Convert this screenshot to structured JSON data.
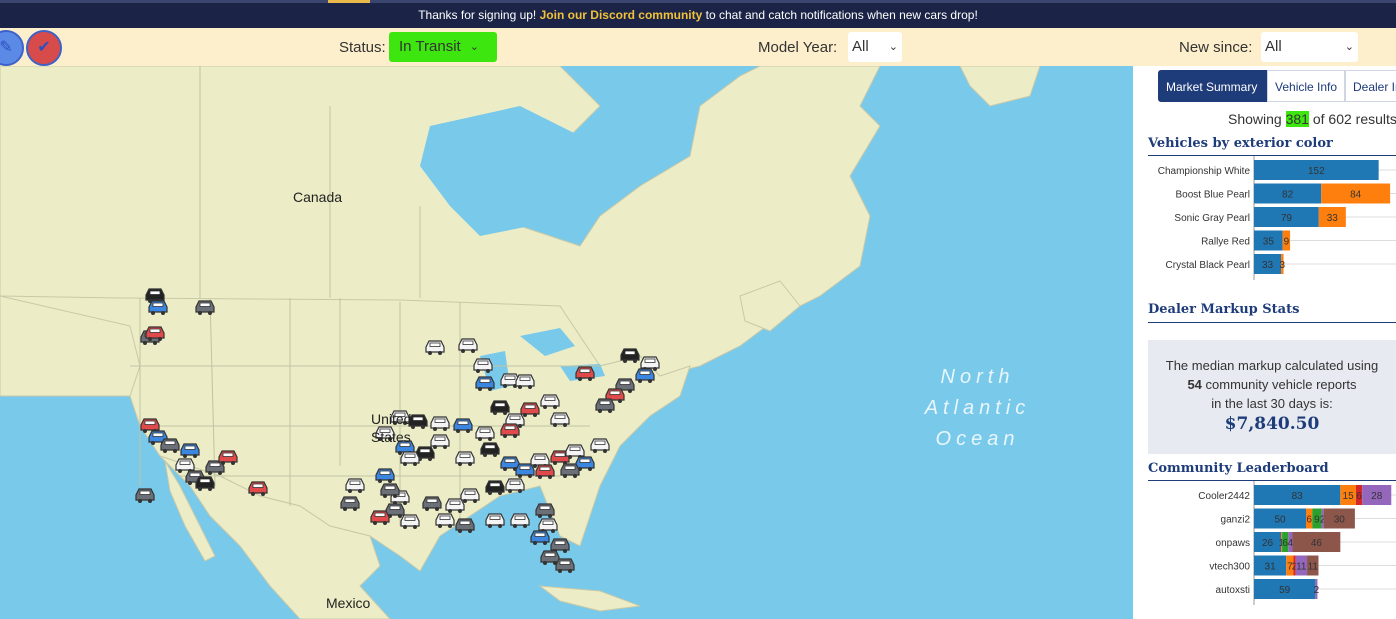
{
  "banner": {
    "prefix": "Thanks for signing up! ",
    "link": "Join our Discord community",
    "suffix": " to chat and catch notifications when new cars drop!"
  },
  "filters": {
    "status_label": "Status:",
    "status_value": "In Transit",
    "model_year_label": "Model Year:",
    "model_year_value": "All",
    "new_since_label": "New since:",
    "new_since_value": "All"
  },
  "map": {
    "labels": {
      "canada": "Canada",
      "us": "United States",
      "mexico": "Mexico"
    },
    "ocean_lines": [
      "North",
      "Atlantic",
      "Ocean"
    ],
    "marker_colors": {
      "white": "#f4f4f4",
      "black": "#222222",
      "blue": "#3a86e0",
      "red": "#e04a4a",
      "gray": "#6b7078"
    }
  },
  "panel": {
    "tabs": [
      "Market Summary",
      "Vehicle Info",
      "Dealer Info"
    ],
    "results": {
      "prefix": "Showing ",
      "shown": "381",
      "middle": " of ",
      "total": "602",
      "suffix": " results"
    },
    "color_title": "Vehicles by exterior color",
    "markup_title": "Dealer Markup Stats",
    "markup_text1": "The median markup calculated using",
    "markup_count": "54",
    "markup_text2": " community vehicle reports",
    "markup_text3": "in the last 30 days is:",
    "markup_amount": "$7,840.50",
    "leaderboard_title": "Community Leaderboard"
  },
  "chart_data": [
    {
      "type": "bar",
      "title": "Vehicles by exterior color",
      "orientation": "horizontal",
      "stacked": true,
      "categories": [
        "Championship White",
        "Boost Blue Pearl",
        "Sonic Gray Pearl",
        "Rallye Red",
        "Crystal Black Pearl"
      ],
      "series": [
        {
          "color": "#1f77b4",
          "values": [
            152,
            82,
            79,
            35,
            33
          ]
        },
        {
          "color": "#ff7f0e",
          "values": [
            null,
            84,
            33,
            9,
            3
          ]
        }
      ]
    },
    {
      "type": "bar",
      "title": "Community Leaderboard",
      "orientation": "horizontal",
      "stacked": true,
      "categories": [
        "Cooler2442",
        "ganzi2",
        "onpaws",
        "vtech300",
        "autoxsti"
      ],
      "series": [
        {
          "color": "#1f77b4",
          "values": [
            83,
            50,
            26,
            31,
            59
          ]
        },
        {
          "color": "#ff7f0e",
          "values": [
            15,
            6,
            1,
            7,
            null
          ]
        },
        {
          "color": "#d62728",
          "values": [
            6,
            null,
            null,
            2,
            null
          ]
        },
        {
          "color": "#2ca02c",
          "values": [
            null,
            9,
            6,
            null,
            null
          ]
        },
        {
          "color": "#9467bd",
          "values": [
            28,
            2,
            4,
            11,
            2
          ]
        },
        {
          "color": "#8c564b",
          "values": [
            null,
            30,
            46,
            11,
            null
          ]
        }
      ]
    }
  ]
}
